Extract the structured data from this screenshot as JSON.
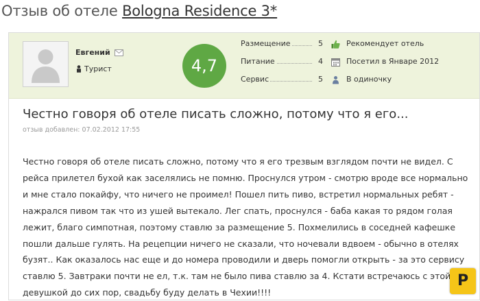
{
  "header": {
    "prefix": "Отзыв об отеле",
    "hotel_name": "Bologna Residence 3*"
  },
  "author": {
    "name": "Евгений",
    "traveler_type": "Турист"
  },
  "overall_score": "4,7",
  "ratings": [
    {
      "label": "Размещение",
      "value": "5"
    },
    {
      "label": "Питание",
      "value": "4"
    },
    {
      "label": "Сервис",
      "value": "5"
    }
  ],
  "meta": {
    "recommends": "Рекомендует отель",
    "visited": "Посетил в Январе 2012",
    "company": "В одиночку"
  },
  "review": {
    "title": "Честно говоря об отеле писать сложно, потому что я его...",
    "date": "отзыв добавлен: 07.02.2012 17:55",
    "body": "Честно говоря об отеле писать сложно, потому что я его трезвым взглядом почти не видел. С рейса прилетел бухой как заселялись не помню. Проснулся утром - смотрю вроде все нормально и мне стало покайфу, что ничего не проимел! Пошел пить пиво, встретил нормальных ребят - нажрался пивом так что из ушей вытекало. Лег спать, проснулся - баба какая то рядом голая лежит, благо симпотная, поэтому ставлю за размещение 5. Похмелились в соседней кафешке пошли дальше гулять. На рецепции ничего не сказали, что ночевали вдвоем - обычно в отелях бузят.. Как оказалось нас еще и до номера проводили и дверь помогли открыть - за это сервису ставлю 5. Завтраки почти не ел, т.к. там не было пива ставлю за 4. Кстати встречаюсь с этой девушкой до сих пор, свадьбу буду делать в Чехии!!!!"
  },
  "watermark": "P",
  "colors": {
    "score_bg": "#5fa844",
    "author_bar_bg": "#eef3dc",
    "accent_icon": "#4a8a2c"
  }
}
